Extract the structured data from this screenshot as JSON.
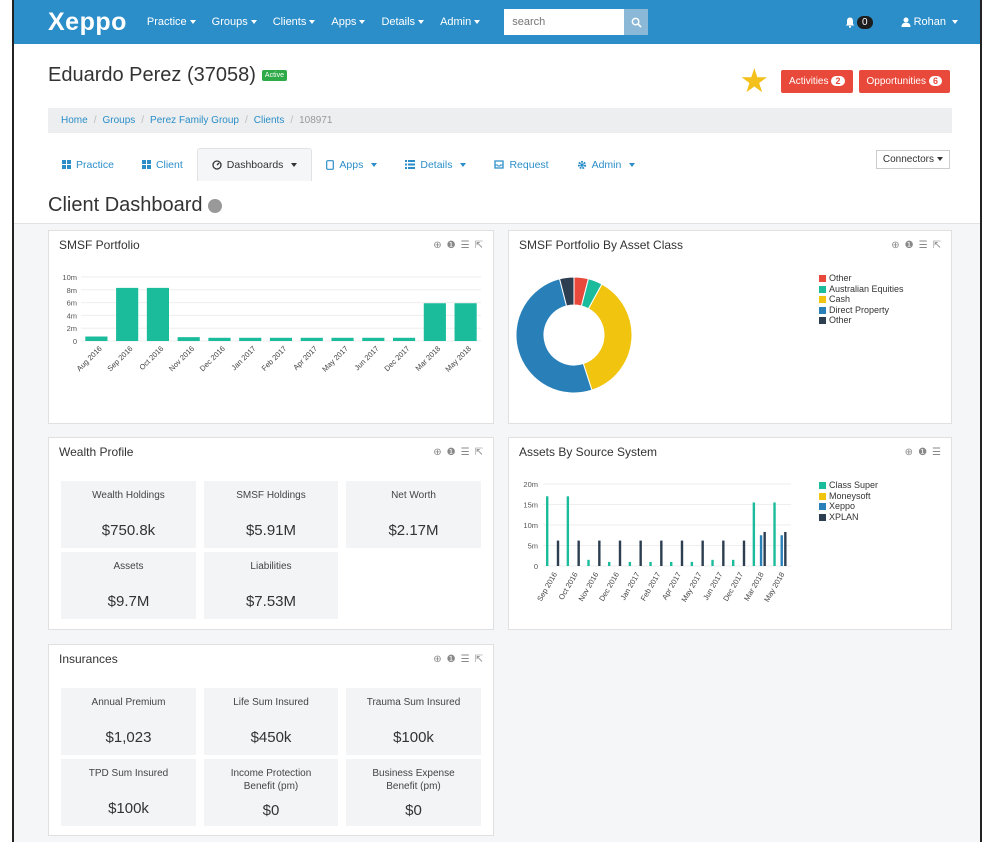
{
  "nav": {
    "logo": "Xeppo",
    "items": [
      "Practice",
      "Groups",
      "Clients",
      "Apps",
      "Details",
      "Admin"
    ],
    "search_placeholder": "search",
    "notifications": "0",
    "user": "Rohan"
  },
  "header": {
    "title": "Eduardo Perez (37058)",
    "status": "Active",
    "activities_label": "Activities",
    "activities_count": "2",
    "opportunities_label": "Opportunities",
    "opportunities_count": "6"
  },
  "breadcrumb": [
    "Home",
    "Groups",
    "Perez Family Group",
    "Clients",
    "108971"
  ],
  "tabs": [
    "Practice",
    "Client",
    "Dashboards",
    "Apps",
    "Details",
    "Request",
    "Admin"
  ],
  "connectors_label": "Connectors",
  "dashboard_title": "Client Dashboard",
  "panels": {
    "smsf_portfolio": "SMSF Portfolio",
    "asset_class": "SMSF Portfolio By Asset Class",
    "wealth_profile": "Wealth Profile",
    "source_system": "Assets By Source System",
    "insurances": "Insurances"
  },
  "wealth": [
    {
      "label": "Wealth Holdings",
      "value": "$750.8k"
    },
    {
      "label": "SMSF Holdings",
      "value": "$5.91M"
    },
    {
      "label": "Net Worth",
      "value": "$2.17M"
    },
    {
      "label": "Assets",
      "value": "$9.7M"
    },
    {
      "label": "Liabilities",
      "value": "$7.53M"
    }
  ],
  "insurance": [
    {
      "label": "Annual Premium",
      "value": "$1,023"
    },
    {
      "label": "Life Sum Insured",
      "value": "$450k"
    },
    {
      "label": "Trauma Sum Insured",
      "value": "$100k"
    },
    {
      "label": "TPD Sum Insured",
      "value": "$100k"
    },
    {
      "label": "Income Protection Benefit (pm)",
      "value": "$0"
    },
    {
      "label": "Business Expense Benefit (pm)",
      "value": "$0"
    }
  ],
  "colors": {
    "accent": "#2b8ec9",
    "teal": "#1abc9c",
    "red": "#e8493a",
    "yellow": "#f1c40f",
    "blue": "#2980b9",
    "navy": "#2c3e50"
  },
  "chart_data": [
    {
      "type": "bar",
      "title": "SMSF Portfolio",
      "categories": [
        "Aug 2016",
        "Sep 2016",
        "Oct 2016",
        "Nov 2016",
        "Dec 2016",
        "Jan 2017",
        "Feb 2017",
        "Apr 2017",
        "May 2017",
        "Jun 2017",
        "Dec 2017",
        "Mar 2018",
        "May 2018"
      ],
      "values": [
        0.7,
        8.3,
        8.3,
        0.6,
        0.5,
        0.5,
        0.5,
        0.5,
        0.5,
        0.5,
        0.5,
        5.9,
        5.9
      ],
      "ylim": [
        0,
        10
      ],
      "yticks": [
        "10m",
        "8m",
        "6m",
        "4m",
        "2m",
        "0"
      ]
    },
    {
      "type": "pie",
      "title": "SMSF Portfolio By Asset Class",
      "legend": "top-right",
      "slices": [
        {
          "name": "Other",
          "value": 4
        },
        {
          "name": "Australian Equities",
          "value": 4
        },
        {
          "name": "Cash",
          "value": 37
        },
        {
          "name": "Direct Property",
          "value": 51
        },
        {
          "name": "Other",
          "value": 4
        }
      ]
    },
    {
      "type": "bar",
      "title": "Assets By Source System",
      "categories": [
        "Sep 2016",
        "Oct 2016",
        "Nov 2016",
        "Dec 2016",
        "Jan 2017",
        "Feb 2017",
        "Apr 2017",
        "May 2017",
        "Jun 2017",
        "Dec 2017",
        "Mar 2018",
        "May 2018"
      ],
      "ylim": [
        0,
        20
      ],
      "yticks": [
        "20m",
        "15m",
        "10m",
        "5m",
        "0"
      ],
      "legend": "top-right",
      "series": [
        {
          "name": "Class Super",
          "values": [
            17,
            17,
            1.5,
            1,
            1,
            1,
            1,
            1,
            1.5,
            1.5,
            15.5,
            15.5
          ]
        },
        {
          "name": "Moneysoft",
          "values": [
            0,
            0,
            0,
            0,
            0,
            0,
            0,
            0,
            0,
            0,
            0,
            0
          ]
        },
        {
          "name": "Xeppo",
          "values": [
            0,
            0,
            0,
            0,
            0,
            0,
            0,
            0,
            0,
            0,
            7.5,
            7.5
          ]
        },
        {
          "name": "XPLAN",
          "values": [
            6.2,
            6.2,
            6.2,
            6.2,
            6.2,
            6.2,
            6.2,
            6.2,
            6.2,
            6.2,
            8.3,
            8.3
          ]
        }
      ]
    }
  ]
}
